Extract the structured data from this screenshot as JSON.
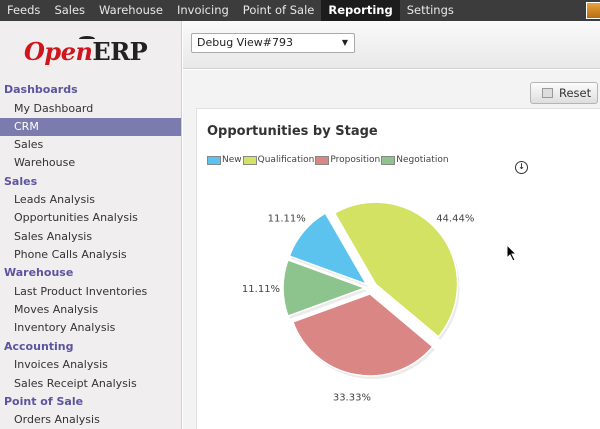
{
  "topnav": {
    "items": [
      {
        "label": "Feeds",
        "active": false
      },
      {
        "label": "Sales",
        "active": false
      },
      {
        "label": "Warehouse",
        "active": false
      },
      {
        "label": "Invoicing",
        "active": false
      },
      {
        "label": "Point of Sale",
        "active": false
      },
      {
        "label": "Reporting",
        "active": true
      },
      {
        "label": "Settings",
        "active": false
      }
    ]
  },
  "logo": {
    "open": "Open",
    "erp": "ERP"
  },
  "sidebar": {
    "sections": [
      {
        "title": "Dashboards",
        "items": [
          {
            "label": "My Dashboard"
          },
          {
            "label": "CRM",
            "selected": true
          },
          {
            "label": "Sales"
          },
          {
            "label": "Warehouse"
          }
        ]
      },
      {
        "title": "Sales",
        "items": [
          {
            "label": "Leads Analysis"
          },
          {
            "label": "Opportunities Analysis"
          },
          {
            "label": "Sales Analysis"
          },
          {
            "label": "Phone Calls Analysis"
          }
        ]
      },
      {
        "title": "Warehouse",
        "items": [
          {
            "label": "Last Product Inventories"
          },
          {
            "label": "Moves Analysis"
          },
          {
            "label": "Inventory Analysis"
          }
        ]
      },
      {
        "title": "Accounting",
        "items": [
          {
            "label": "Invoices Analysis"
          },
          {
            "label": "Sales Receipt Analysis"
          }
        ]
      },
      {
        "title": "Point of Sale",
        "items": [
          {
            "label": "Orders Analysis"
          }
        ]
      }
    ]
  },
  "header": {
    "view_select": "Debug View#793"
  },
  "toolbar": {
    "reset_label": "Reset"
  },
  "chart_data": {
    "type": "pie",
    "title": "Opportunities by Stage",
    "slices": [
      {
        "name": "New",
        "value": 11.11,
        "label": "11.11%",
        "color": "#5bc3ee"
      },
      {
        "name": "Qualification",
        "value": 44.44,
        "label": "44.44%",
        "color": "#d3e262"
      },
      {
        "name": "Proposition",
        "value": 33.33,
        "label": "33.33%",
        "color": "#d98685"
      },
      {
        "name": "Negotiation",
        "value": 11.11,
        "label": "11.11%",
        "color": "#8dc48d"
      }
    ],
    "legend": "top-left"
  }
}
